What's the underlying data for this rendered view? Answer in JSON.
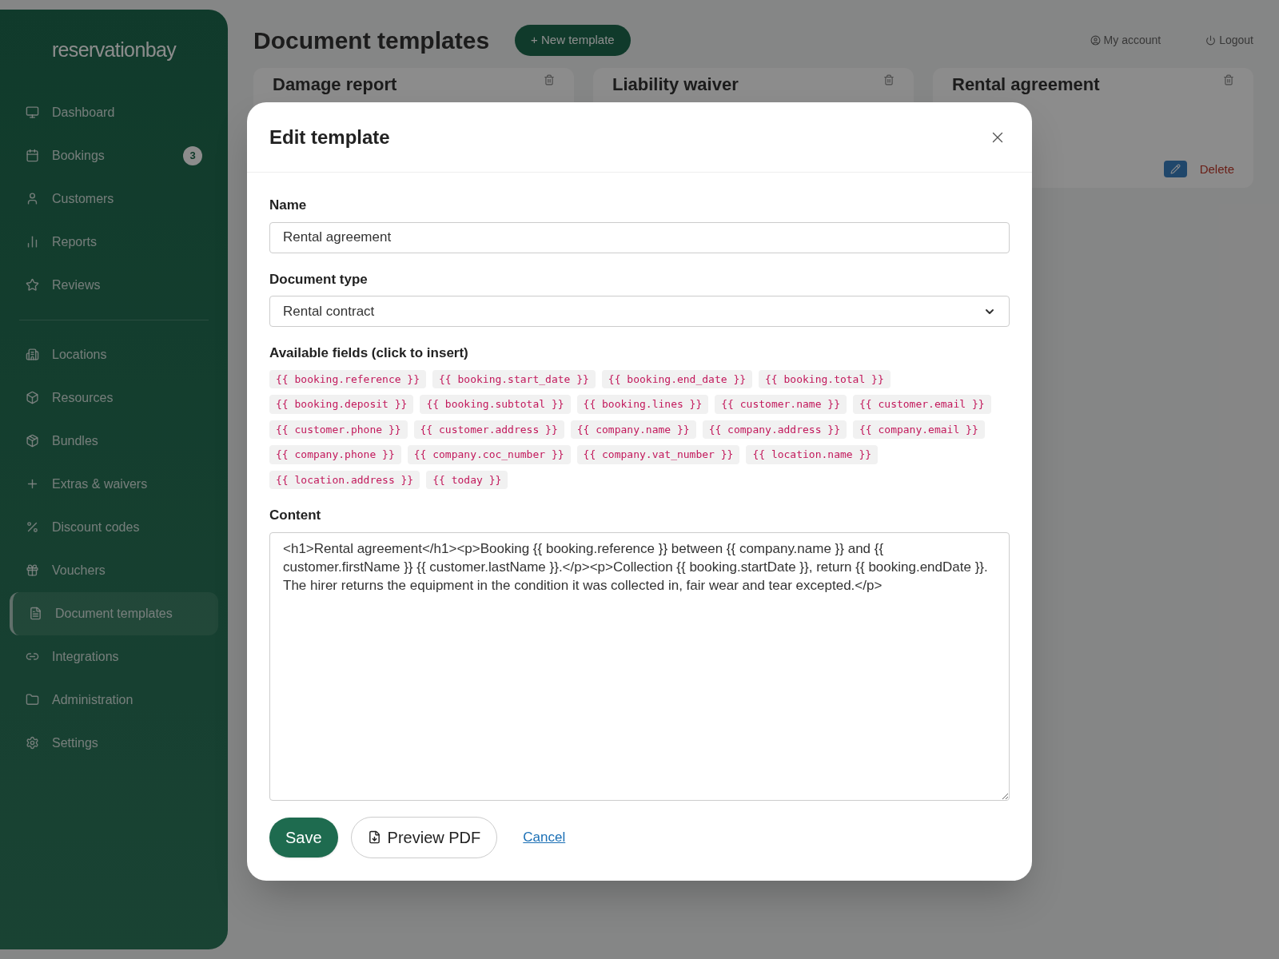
{
  "sidebar": {
    "logo": "reservationbay",
    "groups": [
      {
        "items": [
          {
            "label": "Dashboard",
            "selected": false
          },
          {
            "label": "Bookings",
            "selected": false,
            "badge": "3"
          },
          {
            "label": "Customers",
            "selected": false
          },
          {
            "label": "Reports",
            "selected": false
          },
          {
            "label": "Reviews",
            "selected": false
          }
        ]
      },
      {
        "items": [
          {
            "label": "Locations",
            "selected": false
          },
          {
            "label": "Resources",
            "selected": false
          },
          {
            "label": "Bundles",
            "selected": false
          },
          {
            "label": "Extras & waivers",
            "selected": false
          },
          {
            "label": "Discount codes",
            "selected": false
          },
          {
            "label": "Vouchers",
            "selected": false
          },
          {
            "label": "Document templates",
            "selected": true
          },
          {
            "label": "Integrations",
            "selected": false
          },
          {
            "label": "Administration",
            "selected": false
          },
          {
            "label": "Settings",
            "selected": false
          }
        ]
      }
    ]
  },
  "header": {
    "title": "Document templates",
    "new_button": "+ New template",
    "links": [
      "My account",
      "Logout"
    ]
  },
  "cards": [
    {
      "title": "Damage report"
    },
    {
      "title": "Liability waiver"
    },
    {
      "title": "Rental agreement",
      "delete": "Delete"
    }
  ],
  "modal": {
    "title": "Edit template",
    "name_label": "Name",
    "name_value": "Rental agreement",
    "type_label": "Document type",
    "type_value": "Rental contract",
    "fields_label": "Available fields (click to insert)",
    "fields": [
      "{{ booking.reference }}",
      "{{ booking.start_date }}",
      "{{ booking.end_date }}",
      "{{ booking.total }}",
      "{{ booking.deposit }}",
      "{{ booking.subtotal }}",
      "{{ booking.lines }}",
      "{{ customer.name }}",
      "{{ customer.email }}",
      "{{ customer.phone }}",
      "{{ customer.address }}",
      "{{ company.name }}",
      "{{ company.address }}",
      "{{ company.email }}",
      "{{ company.phone }}",
      "{{ company.coc_number }}",
      "{{ company.vat_number }}",
      "{{ location.name }}",
      "{{ location.address }}",
      "{{ today }}"
    ],
    "content_label": "Content",
    "content": "<h1>Rental agreement</h1><p>Booking {{ booking.reference }} between {{ company.name }} and {{ customer.firstName }} {{ customer.lastName }}.</p><p>Collection {{ booking.startDate }}, return {{ booking.endDate }}. The hirer returns the equipment in the condition it was collected in, fair wear and tear excepted.</p>",
    "save": "Save",
    "preview": "Preview PDF",
    "cancel": "Cancel"
  }
}
